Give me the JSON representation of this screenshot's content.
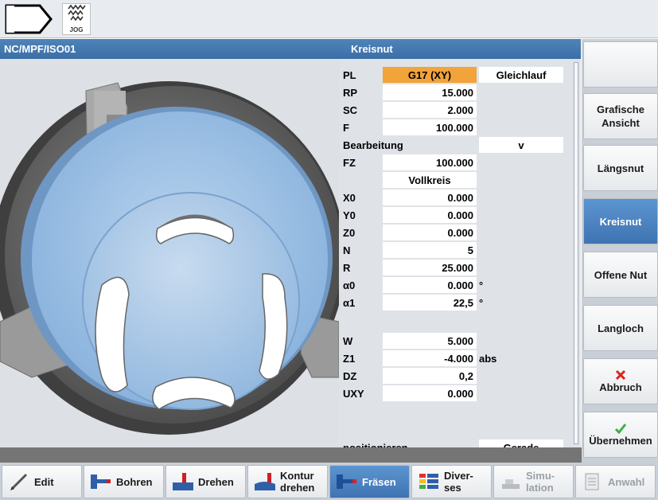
{
  "topbar": {
    "jog_label": "JOG"
  },
  "header": {
    "path": "NC/MPF/ISO01",
    "cycle_title": "Kreisnut"
  },
  "params": [
    {
      "label": "PL",
      "value": "G17 (XY)",
      "style": "orange",
      "side": "Gleichlauf"
    },
    {
      "label": "RP",
      "value": "15.000"
    },
    {
      "label": "SC",
      "value": "2.000"
    },
    {
      "label": "F",
      "value": "100.000"
    },
    {
      "label": "Bearbeitung",
      "side": "v"
    },
    {
      "label": "FZ",
      "value": "100.000"
    },
    {
      "label": "",
      "value": "Vollkreis",
      "style": "center"
    },
    {
      "label": "X0",
      "value": "0.000"
    },
    {
      "label": "Y0",
      "value": "0.000"
    },
    {
      "label": "Z0",
      "value": "0.000"
    },
    {
      "label": "N",
      "value": "5"
    },
    {
      "label": "R",
      "value": "25.000"
    },
    {
      "label": "α0",
      "value": "0.000",
      "unit": "°"
    },
    {
      "label": "α1",
      "value": "22,5",
      "unit": "°"
    },
    {
      "label": "W",
      "value": "5.000"
    },
    {
      "label": "Z1",
      "value": "-4.000",
      "unit": "abs"
    },
    {
      "label": "DZ",
      "value": "0,2"
    },
    {
      "label": "UXY",
      "value": "0.000"
    },
    {
      "label": "positionieren",
      "side": "Gerade"
    }
  ],
  "vertical_softkeys": [
    {
      "label": "",
      "id": "blank"
    },
    {
      "label": "Grafische Ansicht"
    },
    {
      "label": "Längsnut"
    },
    {
      "label": "Kreisnut",
      "active": true
    },
    {
      "label": "Offene Nut"
    },
    {
      "label": "Langloch"
    },
    {
      "label": "Abbruch"
    },
    {
      "label": "Übernehmen"
    }
  ],
  "horizontal_softkeys": [
    {
      "label": "Edit",
      "icon": "pencil-icon"
    },
    {
      "label": "Bohren",
      "icon": "drill-icon"
    },
    {
      "label": "Drehen",
      "icon": "turn-icon"
    },
    {
      "label": "Kontur drehen",
      "icon": "contour-turn-icon"
    },
    {
      "label": "Fräsen",
      "icon": "mill-icon",
      "active": true
    },
    {
      "label": "Diver- ses",
      "icon": "misc-icon"
    },
    {
      "label": "Simu- lation",
      "icon": "simulation-icon",
      "disabled": true
    },
    {
      "label": "Anwahl",
      "icon": "select-icon",
      "disabled": true
    }
  ],
  "colors": {
    "accent": "#3f73b3",
    "highlight": "#f2a33a",
    "cancel": "#e0201a",
    "accept": "#3cb043"
  }
}
